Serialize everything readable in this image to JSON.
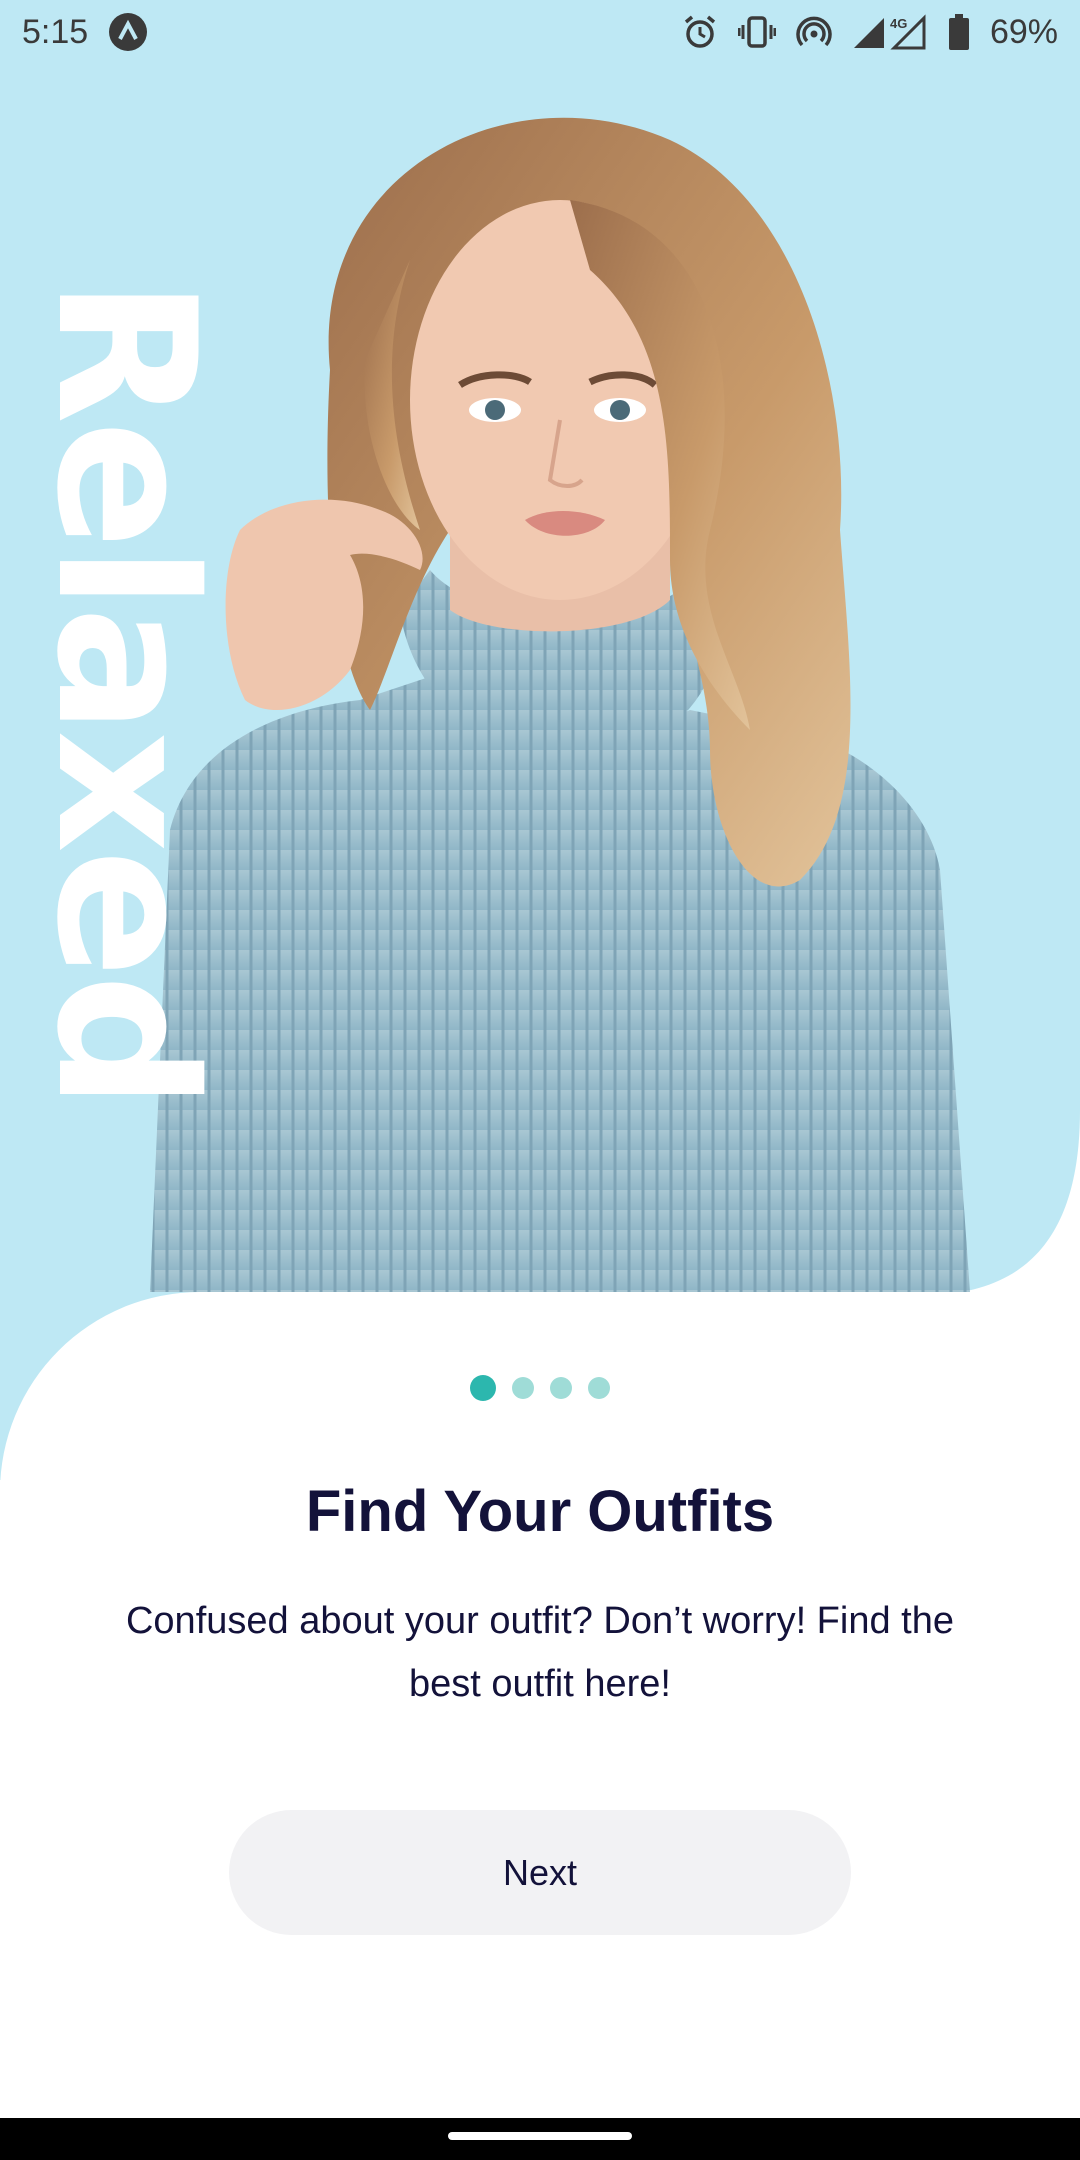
{
  "status_bar": {
    "time": "5:15",
    "battery": "69%",
    "network": "4G",
    "icons": [
      "app-notification-icon",
      "alarm-icon",
      "vibrate-icon",
      "hotspot-icon",
      "signal-icon",
      "battery-icon"
    ]
  },
  "hero": {
    "vertical_word": "Relaxed",
    "background_color": "#BEE8F4"
  },
  "pagination": {
    "count": 4,
    "active_index": 0,
    "active_color": "#2CB7AE",
    "inactive_color": "#9FDCD7"
  },
  "content": {
    "title": "Find Your Outfits",
    "description": "Confused about your outfit? Don’t worry! Find the best outfit here!"
  },
  "actions": {
    "next_label": "Next"
  }
}
